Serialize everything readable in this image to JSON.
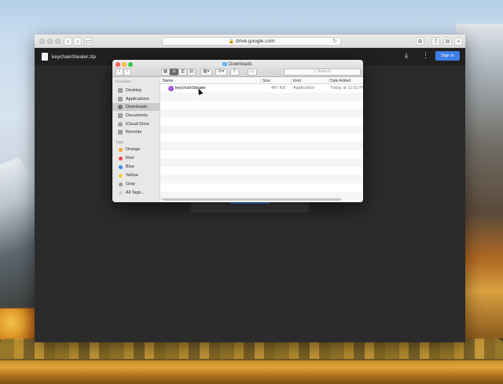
{
  "browser": {
    "url": "drive.google.com",
    "file_name": "keychainStealer.zip",
    "signin_label": "Sign in",
    "nav_back": "‹",
    "nav_forward": "›",
    "reload_icon": "↻"
  },
  "finder": {
    "title": "Downloads",
    "back": "‹",
    "forward": "›",
    "search_placeholder": "Search",
    "sidebar": {
      "favorites_heading": "Favorites",
      "favorites": [
        {
          "label": "Desktop",
          "icon": "desktop-icon"
        },
        {
          "label": "Applications",
          "icon": "applications-icon"
        },
        {
          "label": "Downloads",
          "icon": "downloads-icon",
          "selected": true
        },
        {
          "label": "Documents",
          "icon": "documents-icon"
        },
        {
          "label": "iCloud Drive",
          "icon": "icloud-icon"
        },
        {
          "label": "Recents",
          "icon": "recents-icon"
        }
      ],
      "tags_heading": "Tags",
      "tags": [
        {
          "label": "Orange",
          "color": "#f5a623"
        },
        {
          "label": "Red",
          "color": "#e6474a"
        },
        {
          "label": "Blue",
          "color": "#3f8cf0"
        },
        {
          "label": "Yellow",
          "color": "#f3d13a"
        },
        {
          "label": "Gray",
          "color": "#9a9a9a"
        },
        {
          "label": "All Tags...",
          "color": "#d0d0d0"
        }
      ]
    },
    "columns": {
      "name": "Name",
      "size": "Size",
      "kind": "Kind",
      "date_added": "Date Added"
    },
    "files": [
      {
        "name": "keychainStealer",
        "size": "467 KB",
        "kind": "Application",
        "date_added": "Today at 11:01 PM"
      }
    ]
  },
  "colors": {
    "accent": "#3d7ee6",
    "close": "#fc605c",
    "minimize": "#fdbc40",
    "zoom": "#34c84a"
  }
}
